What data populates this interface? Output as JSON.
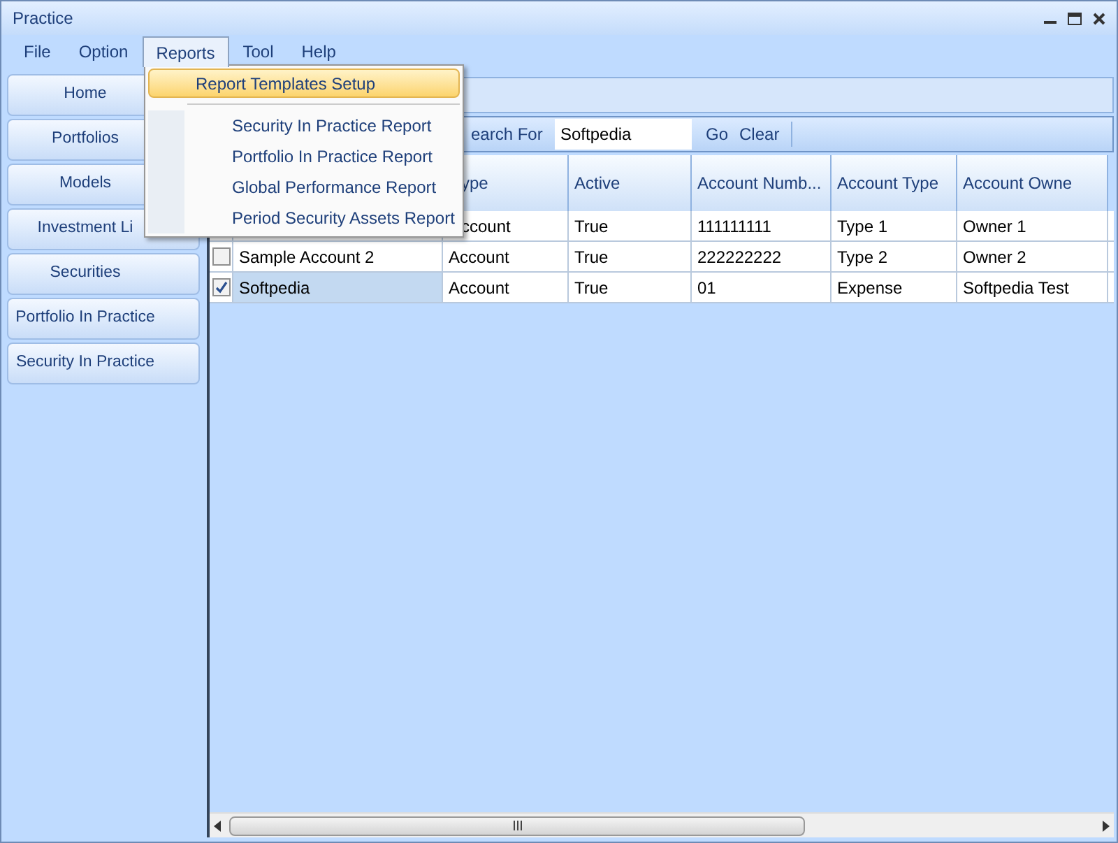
{
  "window": {
    "title": "Practice"
  },
  "menu_bar": [
    {
      "label": "File",
      "selected": false
    },
    {
      "label": "Option",
      "selected": false
    },
    {
      "label": "Reports",
      "selected": true
    },
    {
      "label": "Tool",
      "selected": false
    },
    {
      "label": "Help",
      "selected": false
    }
  ],
  "reports_menu": [
    {
      "kind": "item",
      "label": "Report Templates Setup",
      "selected": true
    },
    {
      "kind": "separator"
    },
    {
      "kind": "item",
      "label": "Security In Practice Report",
      "selected": false
    },
    {
      "kind": "item",
      "label": "Portfolio In Practice Report",
      "selected": false
    },
    {
      "kind": "item",
      "label": "Global Performance Report",
      "selected": false
    },
    {
      "kind": "item",
      "label": "Period Security Assets Report",
      "selected": false
    }
  ],
  "sidebar": {
    "items": [
      "Home",
      "Portfolios",
      "Models",
      "Investment Li",
      "Securities",
      "Portfolio In Practice",
      "Security In Practice"
    ]
  },
  "toolbar": {
    "search_label": "earch For",
    "search_value": "Softpedia",
    "go": "Go",
    "clear": "Clear"
  },
  "table": {
    "columns": [
      "ype",
      "Active",
      "Account Numb...",
      "Account Type",
      "Account Owne"
    ],
    "rows": [
      {
        "cells": [
          "ccount",
          "True",
          "111111111",
          "Type 1",
          "Owner 1"
        ]
      },
      {
        "checked": false,
        "name": "Sample Account 2",
        "selected": false,
        "cells": [
          "Account",
          "True",
          "222222222",
          "Type 2",
          "Owner 2"
        ]
      },
      {
        "checked": true,
        "name": "Softpedia",
        "selected": true,
        "cells": [
          "Account",
          "True",
          "01",
          "Expense",
          "Softpedia Test"
        ]
      }
    ]
  }
}
